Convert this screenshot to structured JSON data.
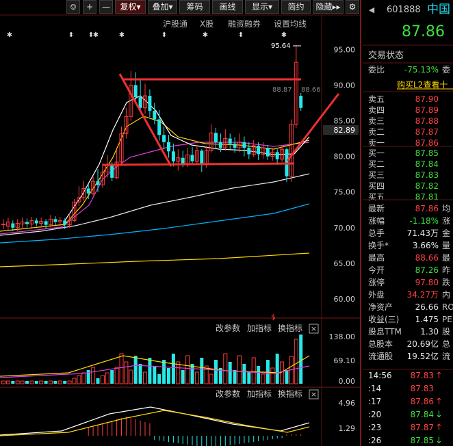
{
  "toolbar": {
    "fq": "复权",
    "dj": "叠加",
    "cm": "筹码",
    "hx": "画线",
    "xs": "显示",
    "jy": "简约",
    "yc": "隐藏"
  },
  "subbar": {
    "hgt": "沪股通",
    "xg": "X股",
    "rzrq": "融资融券",
    "szjx": "设置均线"
  },
  "axis": {
    "p95": "95.00",
    "p90": "90.00",
    "p85": "85.00",
    "p80": "80.00",
    "p75": "75.00",
    "p70": "70.00",
    "p65": "65.00",
    "p60": "60.00",
    "v1": "138.00",
    "v2": "69.10",
    "v3": "0.00",
    "m1": "4.96",
    "m2": "1.29"
  },
  "annot": {
    "high": "95.64",
    "mid": "88.87",
    "mid2": "88.66",
    "cur": "82.89"
  },
  "panel_btn": {
    "gcs": "改参数",
    "jzb": "加指标",
    "hzb": "换指标"
  },
  "quote": {
    "code": "601888",
    "name": "中国",
    "price": "87.86",
    "wb_label": "委比",
    "wb_val": "-75.13%",
    "wc_cut": "委",
    "l2": "购买L2查看十",
    "title": "交易状态"
  },
  "asks": [
    {
      "l": "卖五",
      "p": "87.90"
    },
    {
      "l": "卖四",
      "p": "87.89"
    },
    {
      "l": "卖三",
      "p": "87.88"
    },
    {
      "l": "卖二",
      "p": "87.87"
    },
    {
      "l": "卖一",
      "p": "87.86"
    }
  ],
  "bids": [
    {
      "l": "买一",
      "p": "87.85"
    },
    {
      "l": "买二",
      "p": "87.84"
    },
    {
      "l": "买三",
      "p": "87.83"
    },
    {
      "l": "买四",
      "p": "87.82"
    },
    {
      "l": "买五",
      "p": "87.81"
    }
  ],
  "stats": [
    {
      "l": "最新",
      "v": "87.86",
      "c": "#ff4040",
      "r": "均"
    },
    {
      "l": "涨幅",
      "v": "-1.18%",
      "c": "#3de03d",
      "r": "涨"
    },
    {
      "l": "总手",
      "v": "71.43万",
      "c": "#e6e6e6",
      "r": "金"
    },
    {
      "l": "换手*",
      "v": "3.66%",
      "c": "#e6e6e6",
      "r": "量"
    },
    {
      "l": "最高",
      "v": "88.66",
      "c": "#ff4040",
      "r": "最"
    },
    {
      "l": "今开",
      "v": "87.26",
      "c": "#3de03d",
      "r": "昨"
    },
    {
      "l": "涨停",
      "v": "97.80",
      "c": "#ff4040",
      "r": "跌"
    },
    {
      "l": "外盘",
      "v": "34.27万",
      "c": "#ff4040",
      "r": "内"
    },
    {
      "l": "净资产",
      "v": "26.66",
      "c": "#e6e6e6",
      "r": "RO"
    },
    {
      "l": "收益(三)",
      "v": "1.475",
      "c": "#e6e6e6",
      "r": "PE"
    },
    {
      "l": "股息TTM",
      "v": "1.30",
      "c": "#e6e6e6",
      "r": "股"
    },
    {
      "l": "总股本",
      "v": "20.69亿",
      "c": "#e6e6e6",
      "r": "总"
    },
    {
      "l": "流通股",
      "v": "19.52亿",
      "c": "#e6e6e6",
      "r": "流"
    }
  ],
  "ticks": [
    {
      "t": "14:56",
      "p": "87.83",
      "a": "↑",
      "c": "#ff4040"
    },
    {
      "t": ":14",
      "p": "87.83",
      "a": "",
      "c": "#ff4040"
    },
    {
      "t": ":17",
      "p": "87.86",
      "a": "↑",
      "c": "#ff4040"
    },
    {
      "t": ":20",
      "p": "87.84",
      "a": "↓",
      "c": "#3de03d"
    },
    {
      "t": ":23",
      "p": "87.87",
      "a": "↑",
      "c": "#ff4040"
    },
    {
      "t": ":26",
      "p": "87.85",
      "a": "↓",
      "c": "#3de03d"
    }
  ],
  "chart_data": {
    "type": "candlestick",
    "price_axis": [
      60,
      65,
      70,
      75,
      80,
      85,
      90,
      95
    ],
    "candles": [
      [
        70.5,
        70.5,
        69.8,
        71.2
      ],
      [
        70.2,
        70.8,
        69.6,
        71.4
      ],
      [
        70.6,
        70.0,
        69.5,
        71.0
      ],
      [
        70.0,
        70.6,
        69.5,
        71.2
      ],
      [
        70.5,
        70.8,
        70.0,
        71.4
      ],
      [
        70.8,
        70.5,
        70.0,
        71.3
      ],
      [
        70.5,
        71.0,
        69.8,
        71.5
      ],
      [
        71.0,
        70.6,
        70.2,
        71.3
      ],
      [
        70.6,
        70.9,
        70.0,
        71.4
      ],
      [
        70.9,
        70.4,
        69.8,
        71.2
      ],
      [
        70.4,
        71.2,
        70.0,
        71.8
      ],
      [
        71.2,
        70.8,
        70.3,
        71.6
      ],
      [
        70.8,
        71.0,
        70.2,
        71.5
      ],
      [
        71.0,
        70.4,
        69.8,
        71.3
      ],
      [
        70.4,
        71.0,
        70.0,
        72.0
      ],
      [
        71.0,
        73.6,
        70.8,
        74.0
      ],
      [
        73.6,
        74.2,
        73.0,
        75.8
      ],
      [
        74.2,
        75.5,
        73.8,
        76.6
      ],
      [
        75.5,
        74.8,
        74.0,
        76.2
      ],
      [
        74.8,
        76.5,
        74.5,
        77.2
      ],
      [
        76.5,
        76.0,
        75.0,
        78.2
      ],
      [
        76.0,
        77.8,
        75.6,
        79.0
      ],
      [
        77.8,
        78.8,
        77.0,
        80.2
      ],
      [
        78.8,
        77.0,
        76.5,
        79.2
      ],
      [
        77.0,
        79.2,
        76.8,
        81.0
      ],
      [
        79.2,
        83.2,
        79.0,
        84.2
      ],
      [
        83.2,
        85.6,
        82.5,
        86.8
      ],
      [
        85.6,
        90.0,
        85.0,
        92.0
      ],
      [
        90.0,
        88.3,
        87.5,
        91.8
      ],
      [
        88.3,
        86.8,
        86.2,
        90.8
      ],
      [
        86.8,
        88.5,
        86.0,
        90.2
      ],
      [
        88.5,
        86.4,
        85.5,
        89.4
      ],
      [
        86.4,
        85.2,
        84.5,
        87.5
      ],
      [
        85.2,
        83.0,
        82.2,
        86.5
      ],
      [
        83.0,
        82.0,
        81.0,
        84.2
      ],
      [
        82.0,
        80.7,
        79.8,
        83.0
      ],
      [
        80.7,
        79.3,
        78.6,
        81.8
      ],
      [
        79.3,
        79.8,
        78.0,
        81.0
      ],
      [
        79.8,
        79.0,
        78.5,
        80.8
      ],
      [
        79.0,
        80.2,
        78.5,
        81.2
      ],
      [
        80.2,
        79.3,
        78.8,
        81.3
      ],
      [
        79.3,
        80.8,
        78.8,
        81.6
      ],
      [
        80.8,
        79.0,
        77.8,
        81.0
      ],
      [
        79.0,
        80.8,
        78.4,
        81.5
      ],
      [
        80.8,
        83.3,
        80.5,
        84.5
      ],
      [
        83.3,
        82.0,
        81.0,
        84.0
      ],
      [
        82.0,
        81.2,
        80.6,
        83.2
      ],
      [
        81.2,
        82.5,
        80.8,
        83.8
      ],
      [
        82.5,
        81.8,
        81.0,
        83.2
      ],
      [
        81.8,
        81.2,
        80.5,
        82.7
      ],
      [
        81.2,
        82.0,
        80.6,
        83.2
      ],
      [
        82.0,
        81.2,
        80.0,
        82.8
      ],
      [
        81.2,
        80.3,
        79.6,
        82.0
      ],
      [
        80.3,
        81.5,
        79.9,
        82.3
      ],
      [
        81.5,
        80.3,
        79.5,
        82.0
      ],
      [
        80.3,
        81.2,
        79.7,
        82.0
      ],
      [
        81.2,
        80.0,
        79.5,
        81.6
      ],
      [
        80.0,
        80.6,
        79.4,
        81.2
      ],
      [
        80.6,
        79.6,
        78.8,
        81.0
      ],
      [
        79.6,
        81.0,
        79.2,
        81.4
      ],
      [
        81.0,
        77.2,
        76.4,
        81.2
      ],
      [
        77.2,
        84.5,
        76.4,
        85.2
      ],
      [
        84.5,
        93.2,
        84.0,
        95.6
      ],
      [
        88.5,
        86.8,
        86.4,
        88.9
      ]
    ]
  }
}
